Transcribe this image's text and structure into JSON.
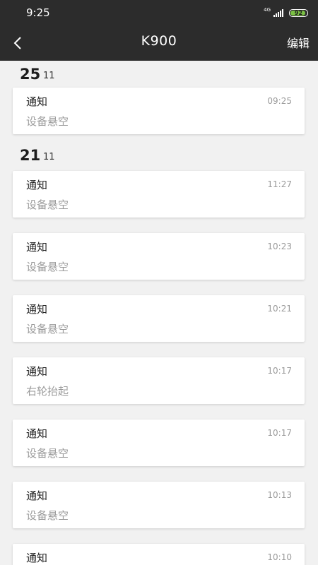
{
  "status_bar": {
    "time": "9:25",
    "network": "4G",
    "battery": "92",
    "battery_level": 0.92
  },
  "header": {
    "title": "K900",
    "edit_label": "编辑",
    "back_icon": "chevron-left-icon"
  },
  "groups": [
    {
      "day": "25",
      "month": "11",
      "items": [
        {
          "title": "通知",
          "time": "09:25",
          "message": "设备悬空"
        }
      ]
    },
    {
      "day": "21",
      "month": "11",
      "items": [
        {
          "title": "通知",
          "time": "11:27",
          "message": "设备悬空"
        },
        {
          "title": "通知",
          "time": "10:23",
          "message": "设备悬空"
        },
        {
          "title": "通知",
          "time": "10:21",
          "message": "设备悬空"
        },
        {
          "title": "通知",
          "time": "10:17",
          "message": "右轮抬起"
        },
        {
          "title": "通知",
          "time": "10:17",
          "message": "设备悬空"
        },
        {
          "title": "通知",
          "time": "10:13",
          "message": "设备悬空"
        },
        {
          "title": "通知",
          "time": "10:10",
          "message": ""
        }
      ]
    }
  ]
}
